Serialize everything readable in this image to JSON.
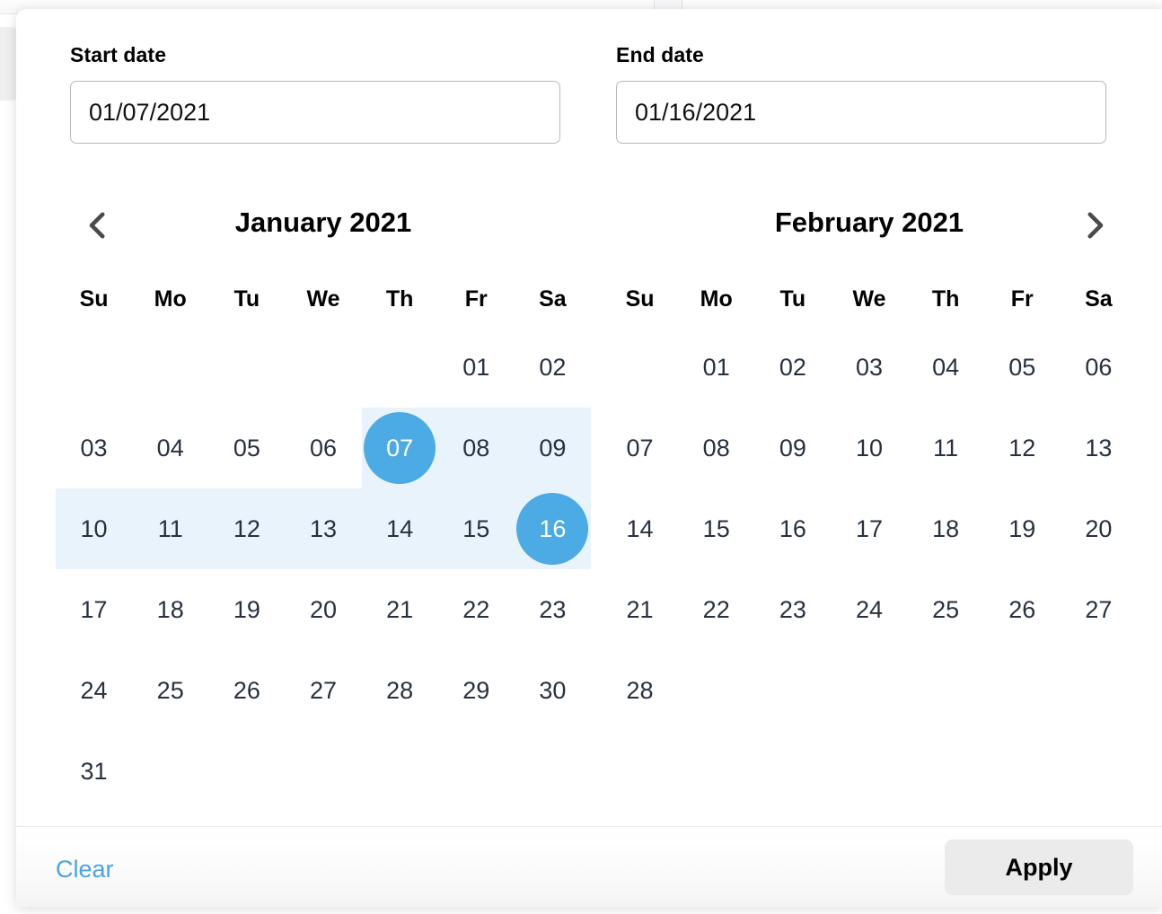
{
  "theme": {
    "accent": "#4caae4",
    "range_band": "#e8f3fc",
    "link": "#4ba3e3",
    "day_text": "#28313f",
    "button_bg": "#ebebeb"
  },
  "fields": {
    "start": {
      "label": "Start date",
      "value": "01/07/2021",
      "placeholder": "MM/DD/YYYY"
    },
    "end": {
      "label": "End date",
      "value": "01/16/2021",
      "placeholder": "MM/DD/YYYY"
    }
  },
  "nav": {
    "prev_icon": "chevron-left-icon",
    "next_icon": "chevron-right-icon"
  },
  "weekdays": [
    "Su",
    "Mo",
    "Tu",
    "We",
    "Th",
    "Fr",
    "Sa"
  ],
  "calendars": [
    {
      "title": "January 2021",
      "weeks": [
        [
          "",
          "",
          "",
          "",
          "",
          "01",
          "02"
        ],
        [
          "03",
          "04",
          "05",
          "06",
          "07",
          "08",
          "09"
        ],
        [
          "10",
          "11",
          "12",
          "13",
          "14",
          "15",
          "16"
        ],
        [
          "17",
          "18",
          "19",
          "20",
          "21",
          "22",
          "23"
        ],
        [
          "24",
          "25",
          "26",
          "27",
          "28",
          "29",
          "30"
        ],
        [
          "31",
          "",
          "",
          "",
          "",
          "",
          ""
        ]
      ],
      "selected": [
        "07",
        "16"
      ],
      "in_range": [
        "08",
        "09",
        "10",
        "11",
        "12",
        "13",
        "14",
        "15"
      ],
      "bands": [
        {
          "week": 1,
          "from_col": 4,
          "to_col": 6
        },
        {
          "week": 2,
          "from_col": 0,
          "to_col": 6
        }
      ]
    },
    {
      "title": "February 2021",
      "weeks": [
        [
          "",
          "01",
          "02",
          "03",
          "04",
          "05",
          "06"
        ],
        [
          "07",
          "08",
          "09",
          "10",
          "11",
          "12",
          "13"
        ],
        [
          "14",
          "15",
          "16",
          "17",
          "18",
          "19",
          "20"
        ],
        [
          "21",
          "22",
          "23",
          "24",
          "25",
          "26",
          "27"
        ],
        [
          "28",
          "",
          "",
          "",
          "",
          "",
          ""
        ]
      ],
      "selected": [],
      "in_range": [],
      "bands": []
    }
  ],
  "footer": {
    "clear_label": "Clear",
    "apply_label": "Apply"
  }
}
